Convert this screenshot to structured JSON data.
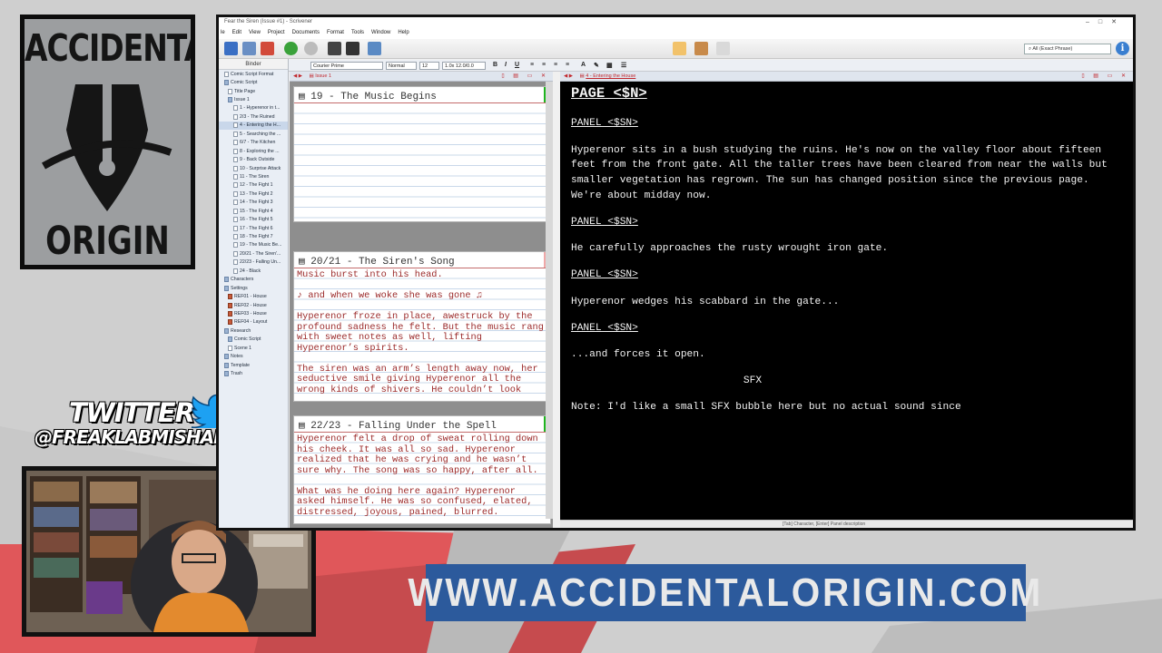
{
  "logo": {
    "line1": "ACCIDENTAL",
    "line2": "ORIGIN"
  },
  "twitter": {
    "label": "TWITTER",
    "handle": "@FREAKLABMISHAP",
    "icon": "bird-icon"
  },
  "website": {
    "url": "WWW.ACCIDENTALORIGIN.COM"
  },
  "app": {
    "title": "Fear the Siren (Issue #1) - Scrivener",
    "menu": [
      "le",
      "Edit",
      "View",
      "Project",
      "Documents",
      "Format",
      "Tools",
      "Window",
      "Help"
    ],
    "search_placeholder": "All (Exact Phrase)",
    "format": {
      "style": "Courier Prime",
      "weight": "Normal",
      "size": "12",
      "spacing": "1.0x 12.0/0.0"
    },
    "binder": {
      "header": "Binder",
      "items": [
        "Comic Script Format",
        "Comic Script",
        "Title Page",
        "Issue 1",
        "1 - Hyperenor in t...",
        "2/3 - The Ruined",
        "4 - Entering the H...",
        "5 - Searching the ...",
        "6/7 - The Kitchen",
        "8 - Exploring the ...",
        "9 - Back Outside",
        "10 - Surprise Attack",
        "11 - The Siren",
        "12 - The Fight 1",
        "13 - The Fight 2",
        "14 - The Fight 3",
        "15 - The Fight 4",
        "16 - The Fight 5",
        "17 - The Fight 6",
        "18 - The Fight 7",
        "19 - The Music Be...",
        "20/21 - The Siren'...",
        "22/23 - Falling Un...",
        "24 - Black",
        "Characters",
        "Settings",
        "REF01 - House",
        "REF02 - House",
        "REF03 - House",
        "REF04 - Layout",
        "Research",
        "Comic Script",
        "Scene 1",
        "Notes",
        "Template",
        "Trash"
      ]
    },
    "left_pane": {
      "breadcrumb": "Issue 1",
      "cards": [
        {
          "title": "19 - The Music Begins",
          "paragraphs": []
        },
        {
          "title": "20/21 - The Siren's Song",
          "paragraphs": [
            "Music burst into his head.",
            "♪ and when we woke she was gone ♫",
            "Hyperenor froze in place, awestruck by the profound sadness he felt. But the music rang with sweet notes as well, lifting Hyperenor’s spirits.",
            "The siren was an arm’s length away now, her seductive smile giving Hyperenor all the wrong kinds of shivers. He couldn’t look"
          ]
        },
        {
          "title": "22/23 - Falling Under the Spell",
          "paragraphs": [
            "Hyperenor felt a drop of sweat rolling down his cheek. It was all so sad. Hyperenor realized that he was crying and he wasn’t sure why. The song was so happy, after all.",
            "What was he doing here again? Hyperenor asked himself. He was so confused, elated, distressed, joyous, pained, blurred."
          ]
        }
      ]
    },
    "editor": {
      "breadcrumb": "4 - Entering the House",
      "page_heading": "PAGE <$N>",
      "blocks": [
        {
          "kind": "panel",
          "text": "PANEL <$SN>"
        },
        {
          "kind": "text",
          "text": "Hyperenor sits in a bush studying the ruins. He's now on the valley floor about fifteen feet from the front gate. All the taller trees have been cleared from near the walls but smaller vegetation has regrown. The sun has changed position since the previous page. We're about midday now."
        },
        {
          "kind": "panel",
          "text": "PANEL <$SN>"
        },
        {
          "kind": "text",
          "text": "He carefully approaches the rusty wrought iron gate."
        },
        {
          "kind": "panel",
          "text": "PANEL <$SN>"
        },
        {
          "kind": "text",
          "text": "Hyperenor wedges his scabbard in the gate..."
        },
        {
          "kind": "panel",
          "text": "PANEL <$SN>"
        },
        {
          "kind": "text",
          "text": "...and forces it open."
        },
        {
          "kind": "sfx",
          "text": "SFX"
        },
        {
          "kind": "text",
          "text": "Note: I'd like a small SFX bubble here but no actual sound since"
        }
      ],
      "status": "[Tab] Character, [Enter] Panel description"
    }
  },
  "colors": {
    "brand_blue": "#2c5a9c",
    "red_swoosh": "#d9534f",
    "accent_red": "#c1272d"
  }
}
